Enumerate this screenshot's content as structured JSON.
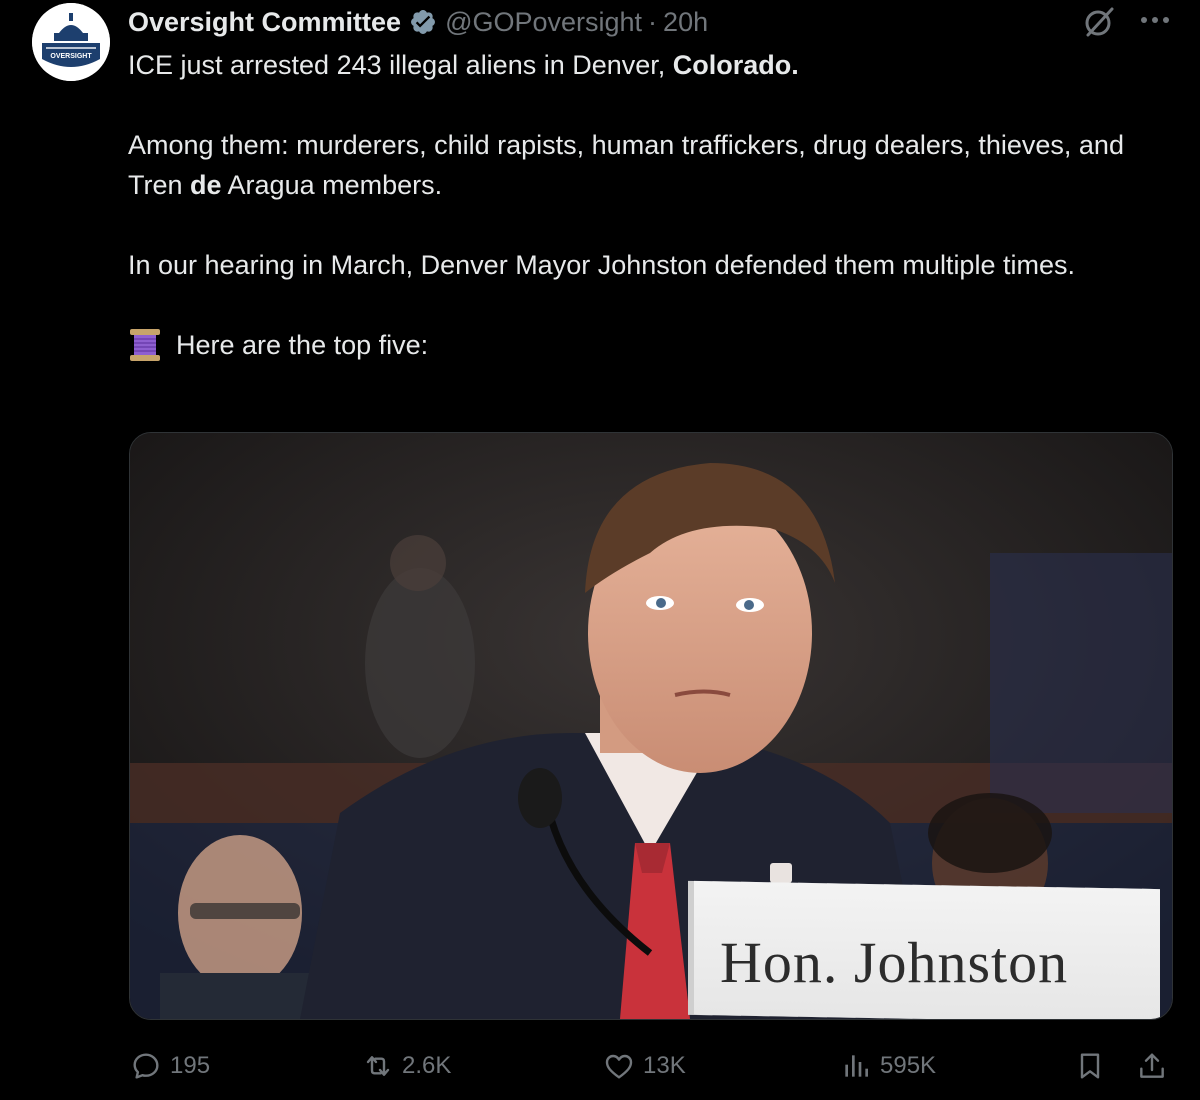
{
  "account": {
    "display_name": "Oversight Committee",
    "handle": "@GOPoversight",
    "separator": "·",
    "time": "20h",
    "avatar_logo": "OVERSIGHT",
    "verified_icon": "verified-badge-icon"
  },
  "tweet": {
    "line1_text": "ICE just arrested 243 illegal aliens in Denver, ",
    "line1_bold": "Colorado.",
    "para2_part1": "Among them: murderers, child rapists, human traffickers, drug dealers, thieves, and Tren ",
    "para2_bold": "de",
    "para2_part2": " Aragua members.",
    "para3": "In our hearing in March, Denver Mayor Johnston defended them multiple times.",
    "para4": "Here are the top five:",
    "thread_icon": "spool-of-thread-icon"
  },
  "media": {
    "nameplate_text": "Hon. Johnston"
  },
  "actions": {
    "replies": "195",
    "reposts": "2.6K",
    "likes": "13K",
    "views": "595K"
  },
  "colors": {
    "background": "#000000",
    "text_primary": "#e7e9ea",
    "text_secondary": "#71767b",
    "verified": "#829aab",
    "border": "#2f3336"
  }
}
